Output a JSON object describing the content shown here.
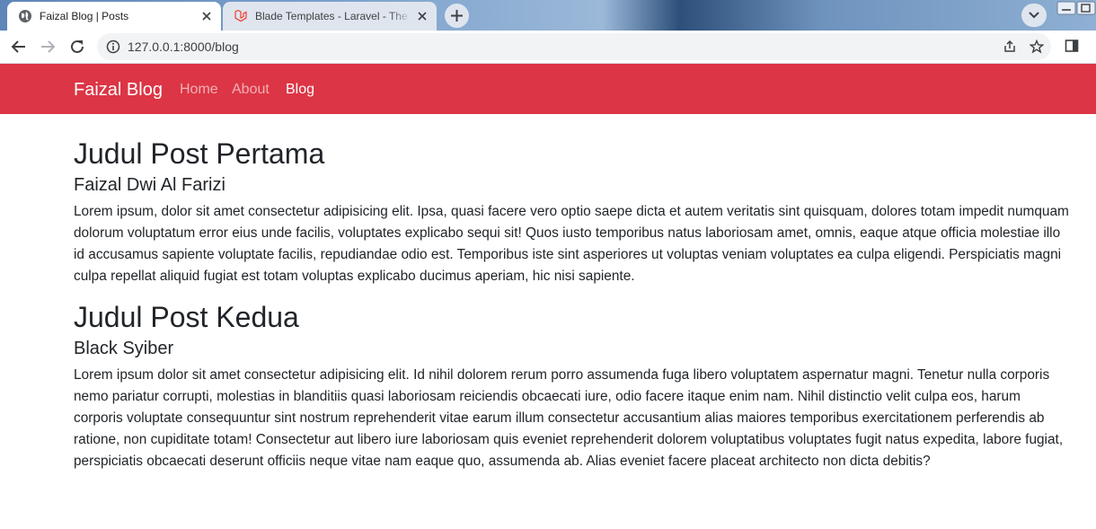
{
  "browser": {
    "tabs": [
      {
        "title": "Faizal Blog | Posts",
        "active": true,
        "favicon": "globe-icon"
      },
      {
        "title": "Blade Templates - Laravel - The PHP Framework",
        "active": false,
        "favicon": "laravel-icon"
      }
    ],
    "url": "127.0.0.1:8000/blog",
    "accent_color": "#dc3545"
  },
  "site": {
    "brand": "Faizal Blog",
    "nav": [
      {
        "label": "Home",
        "active": false
      },
      {
        "label": "About",
        "active": false
      },
      {
        "label": "Blog",
        "active": true
      }
    ]
  },
  "posts": [
    {
      "title": "Judul Post Pertama",
      "author": "Faizal Dwi Al Farizi",
      "body": "Lorem ipsum, dolor sit amet consectetur adipisicing elit. Ipsa, quasi facere vero optio saepe dicta et autem veritatis sint quisquam, dolores totam impedit numquam dolorum voluptatum error eius unde facilis, voluptates explicabo sequi sit! Quos iusto temporibus natus laboriosam amet, omnis, eaque atque officia molestiae illo id accusamus sapiente voluptate facilis, repudiandae odio est. Temporibus iste sint asperiores ut voluptas veniam voluptates ea culpa eligendi. Perspiciatis magni culpa repellat aliquid fugiat est totam voluptas explicabo ducimus aperiam, hic nisi sapiente."
    },
    {
      "title": "Judul Post Kedua",
      "author": "Black Syiber",
      "body": "Lorem ipsum dolor sit amet consectetur adipisicing elit. Id nihil dolorem rerum porro assumenda fuga libero voluptatem aspernatur magni. Tenetur nulla corporis nemo pariatur corrupti, molestias in blanditiis quasi laboriosam reiciendis obcaecati iure, odio facere itaque enim nam. Nihil distinctio velit culpa eos, harum corporis voluptate consequuntur sint nostrum reprehenderit vitae earum illum consectetur accusantium alias maiores temporibus exercitationem perferendis ab ratione, non cupiditate totam! Consectetur aut libero iure laboriosam quis eveniet reprehenderit dolorem voluptatibus voluptates fugit natus expedita, labore fugiat, perspiciatis obcaecati deserunt officiis neque vitae nam eaque quo, assumenda ab. Alias eveniet facere placeat architecto non dicta debitis?"
    }
  ]
}
